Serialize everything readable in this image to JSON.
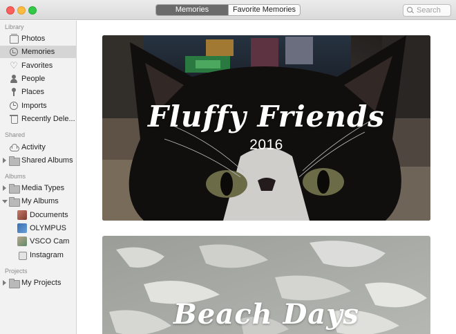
{
  "tabs": {
    "memories": "Memories",
    "favorite": "Favorite Memories"
  },
  "search": {
    "placeholder": "Search"
  },
  "sidebar": {
    "library_header": "Library",
    "shared_header": "Shared",
    "albums_header": "Albums",
    "projects_header": "Projects",
    "items": {
      "photos": "Photos",
      "memories": "Memories",
      "favorites": "Favorites",
      "people": "People",
      "places": "Places",
      "imports": "Imports",
      "recently_deleted": "Recently Dele...",
      "activity": "Activity",
      "shared_albums": "Shared Albums",
      "media_types": "Media Types",
      "my_albums": "My Albums",
      "documents": "Documents",
      "olympus": "OLYMPUS",
      "vsco": "VSCO Cam",
      "instagram": "Instagram",
      "my_projects": "My Projects"
    },
    "selected": "memories"
  },
  "memories": [
    {
      "title": "Fluffy Friends",
      "subtitle": "2016"
    },
    {
      "title": "Beach Days",
      "subtitle": ""
    }
  ],
  "colors": {
    "sidebar_bg": "#f2f2f2",
    "selected_bg": "#d5d5d5",
    "segment_active": "#6b6b6b"
  }
}
